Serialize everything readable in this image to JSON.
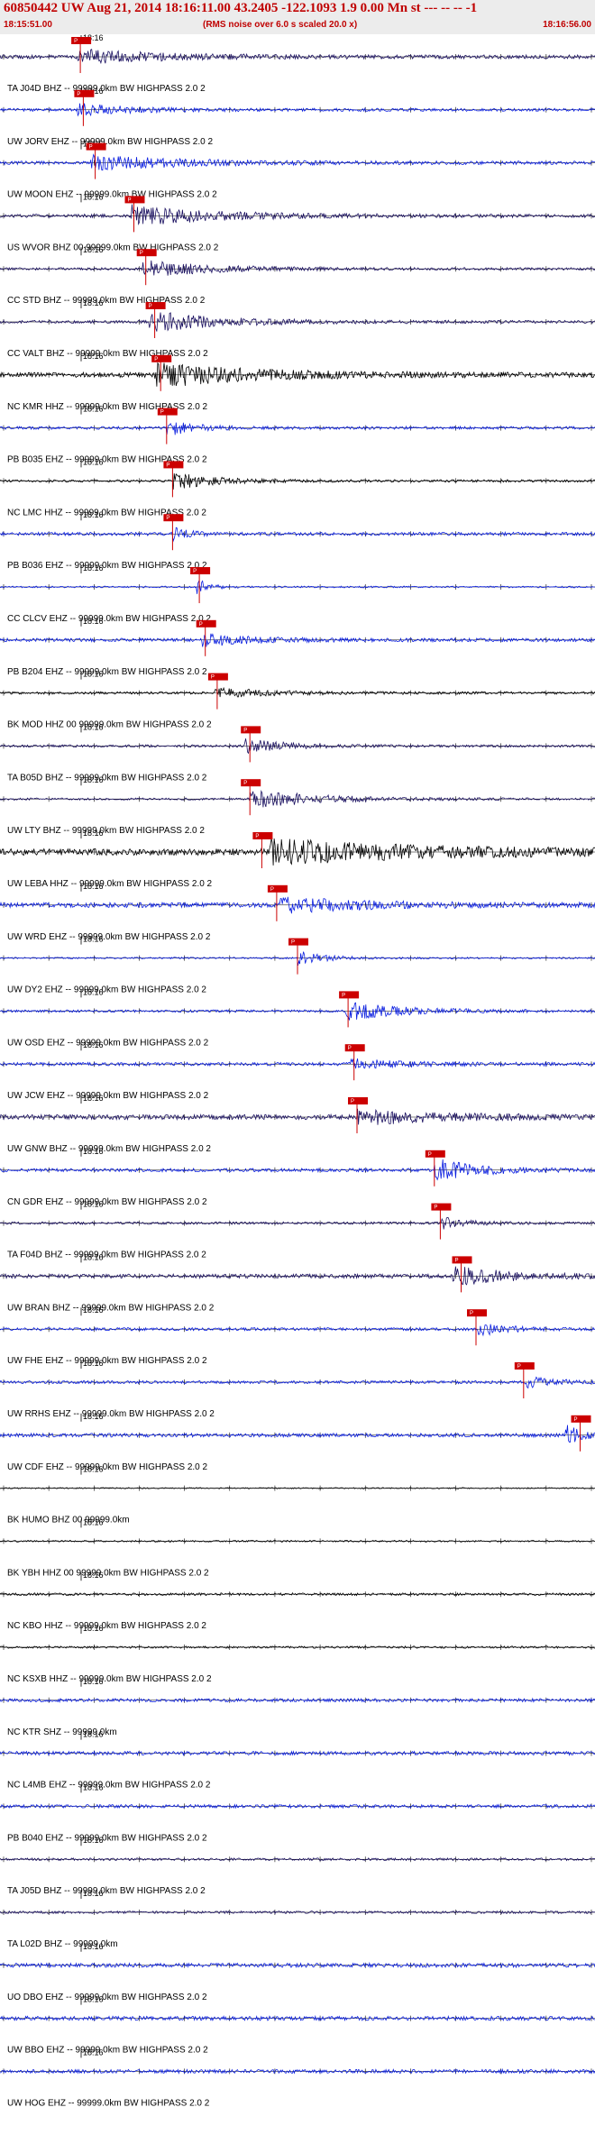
{
  "header": {
    "title": "60850442 UW Aug 21, 2014 18:16:11.00   43.2405 -122.1093  1.9 0.00 Mn st --- -- --  -1",
    "start_time": "18:15:51.00",
    "note": "(RMS noise over 6.0 s scaled 20.0 x)",
    "end_time": "18:16:56.00"
  },
  "chart_data": {
    "type": "line",
    "title": "60850442 UW Aug 21, 2014 18:16:11.00   43.2405 -122.1093  1.9 0.00 Mn st --- -- --  -1",
    "subtitle": "(RMS noise over 6.0 s scaled 20.0 x)",
    "x_range": [
      "18:15:51.00",
      "18:16:56.00"
    ],
    "minute_mark": "18:16",
    "pick_label": "P",
    "colors": {
      "dark": "#1a1060",
      "blue": "#0a1ee0",
      "black": "#000000",
      "pick": "#cc0000"
    },
    "traces": [
      {
        "name": "TA J04D BHZ -- 99999.0km BW  HIGHPASS  2.0  2",
        "color": "dark",
        "pick": 0.135,
        "event": [
          0.13,
          0.3,
          0.6
        ],
        "noise": 0.45
      },
      {
        "name": "UW JORV EHZ -- 99999.0km BW  HIGHPASS  2.0  2",
        "color": "blue",
        "pick": 0.14,
        "event": [
          0.13,
          0.2,
          0.5
        ],
        "noise": 0.35
      },
      {
        "name": "UW MOON EHZ -- 99999.0km BW  HIGHPASS  2.0  2",
        "color": "blue",
        "pick": 0.16,
        "event": [
          0.15,
          0.35,
          0.6
        ],
        "noise": 0.4
      },
      {
        "name": "US WVOR BHZ 00 99999.0km BW  HIGHPASS  2.0  2",
        "color": "dark",
        "pick": 0.225,
        "event": [
          0.22,
          0.3,
          0.9
        ],
        "noise": 0.4
      },
      {
        "name": "CC STD BHZ -- 99999.0km BW  HIGHPASS  2.0  2",
        "color": "dark",
        "pick": 0.245,
        "event": [
          0.24,
          0.25,
          0.7
        ],
        "noise": 0.3
      },
      {
        "name": "CC VALT BHZ -- 99999.0km BW  HIGHPASS  2.0  2",
        "color": "dark",
        "pick": 0.26,
        "event": [
          0.25,
          0.25,
          0.9
        ],
        "noise": 0.35
      },
      {
        "name": "NC KMR HHZ -- 99999.0km BW  HIGHPASS  2.0  2",
        "color": "black",
        "pick": 0.27,
        "event": [
          0.26,
          0.35,
          1.0
        ],
        "noise": 0.6
      },
      {
        "name": "PB B035 EHZ -- 99999.0km BW  HIGHPASS  2.0  2",
        "color": "blue",
        "pick": 0.28,
        "event": [
          0.28,
          0.1,
          0.7
        ],
        "noise": 0.35
      },
      {
        "name": "NC LMC HHZ -- 99999.0km BW  HIGHPASS  2.0  2",
        "color": "black",
        "pick": 0.29,
        "event": [
          0.29,
          0.15,
          0.7
        ],
        "noise": 0.3
      },
      {
        "name": "PB B036 EHZ -- 99999.0km BW  HIGHPASS  2.0  2",
        "color": "blue",
        "pick": 0.29,
        "event": [
          0.29,
          0.05,
          0.6
        ],
        "noise": 0.4
      },
      {
        "name": "CC CLCV EHZ -- 99999.0km BW  HIGHPASS  2.0  2",
        "color": "blue",
        "pick": 0.335,
        "event": [
          0.33,
          0.05,
          0.7
        ],
        "noise": 0.2
      },
      {
        "name": "PB B204 EHZ -- 99999.0km BW  HIGHPASS  2.0  2",
        "color": "blue",
        "pick": 0.345,
        "event": [
          0.34,
          0.2,
          0.5
        ],
        "noise": 0.4
      },
      {
        "name": "BK MOD HHZ 00 99999.0km BW  HIGHPASS  2.0  2",
        "color": "black",
        "pick": 0.365,
        "event": [
          0.36,
          0.2,
          0.4
        ],
        "noise": 0.3
      },
      {
        "name": "TA B05D BHZ -- 99999.0km BW  HIGHPASS  2.0  2",
        "color": "dark",
        "pick": 0.42,
        "event": [
          0.41,
          0.15,
          0.6
        ],
        "noise": 0.3
      },
      {
        "name": "UW LTY BHZ -- 99999.0km BW  HIGHPASS  2.0  2",
        "color": "dark",
        "pick": 0.42,
        "event": [
          0.42,
          0.25,
          0.8
        ],
        "noise": 0.25
      },
      {
        "name": "UW LEBA HHZ -- 99999.0km BW  HIGHPASS  2.0  2",
        "color": "black",
        "pick": 0.44,
        "event": [
          0.45,
          0.55,
          1.0
        ],
        "noise": 0.8
      },
      {
        "name": "UW WRD EHZ -- 99999.0km BW  HIGHPASS  2.0  2",
        "color": "blue",
        "pick": 0.465,
        "event": [
          0.47,
          0.3,
          0.6
        ],
        "noise": 0.6
      },
      {
        "name": "UW DY2 EHZ -- 99999.0km BW  HIGHPASS  2.0  2",
        "color": "blue",
        "pick": 0.5,
        "event": [
          0.5,
          0.1,
          0.6
        ],
        "noise": 0.2
      },
      {
        "name": "UW OSD EHZ -- 99999.0km BW  HIGHPASS  2.0  2",
        "color": "blue",
        "pick": 0.585,
        "event": [
          0.58,
          0.2,
          0.8
        ],
        "noise": 0.3
      },
      {
        "name": "UW JCW EHZ -- 99999.0km BW  HIGHPASS  2.0  2",
        "color": "blue",
        "pick": 0.595,
        "event": [
          0.59,
          0.2,
          0.4
        ],
        "noise": 0.4
      },
      {
        "name": "UW GNW BHZ -- 99999.0km BW  HIGHPASS  2.0  2",
        "color": "dark",
        "pick": 0.6,
        "event": [
          0.6,
          0.3,
          0.6
        ],
        "noise": 0.6
      },
      {
        "name": "CN GDR EHZ -- 99999.0km BW  HIGHPASS  2.0  2",
        "color": "blue",
        "pick": 0.73,
        "event": [
          0.73,
          0.15,
          1.0
        ],
        "noise": 0.4
      },
      {
        "name": "TA F04D BHZ -- 99999.0km BW  HIGHPASS  2.0  2",
        "color": "dark",
        "pick": 0.74,
        "event": [
          0.74,
          0.1,
          0.5
        ],
        "noise": 0.3
      },
      {
        "name": "UW BRAN BHZ -- 99999.0km BW  HIGHPASS  2.0  2",
        "color": "dark",
        "pick": 0.775,
        "event": [
          0.76,
          0.2,
          0.8
        ],
        "noise": 0.5
      },
      {
        "name": "UW FHE EHZ -- 99999.0km BW  HIGHPASS  2.0  2",
        "color": "blue",
        "pick": 0.8,
        "event": [
          0.8,
          0.1,
          0.6
        ],
        "noise": 0.35
      },
      {
        "name": "UW RRHS EHZ -- 99999.0km BW  HIGHPASS  2.0  2",
        "color": "blue",
        "pick": 0.88,
        "event": [
          0.88,
          0.1,
          0.5
        ],
        "noise": 0.35
      },
      {
        "name": "UW CDF EHZ -- 99999.0km BW  HIGHPASS  2.0  2",
        "color": "blue",
        "pick": 0.975,
        "event": [
          0.95,
          0.05,
          1.0
        ],
        "noise": 0.45
      },
      {
        "name": "BK HUMO BHZ 00 99999.0km",
        "color": "black",
        "pick": null,
        "event": null,
        "noise": 0.15
      },
      {
        "name": "BK YBH HHZ 00 99999.0km BW  HIGHPASS  2.0  2",
        "color": "black",
        "pick": null,
        "event": null,
        "noise": 0.2
      },
      {
        "name": "NC KBO HHZ -- 99999.0km BW  HIGHPASS  2.0  2",
        "color": "black",
        "pick": null,
        "event": null,
        "noise": 0.3
      },
      {
        "name": "NC KSXB HHZ -- 99999.0km BW  HIGHPASS  2.0  2",
        "color": "black",
        "pick": null,
        "event": null,
        "noise": 0.25
      },
      {
        "name": "NC KTR SHZ -- 99999.0km",
        "color": "blue",
        "pick": null,
        "event": null,
        "noise": 0.4
      },
      {
        "name": "NC L4MB EHZ -- 99999.0km BW  HIGHPASS  2.0  2",
        "color": "blue",
        "pick": null,
        "event": null,
        "noise": 0.45
      },
      {
        "name": "PB B040 EHZ -- 99999.0km BW  HIGHPASS  2.0  2",
        "color": "blue",
        "pick": null,
        "event": null,
        "noise": 0.4
      },
      {
        "name": "TA J05D BHZ -- 99999.0km BW  HIGHPASS  2.0  2",
        "color": "dark",
        "pick": null,
        "event": null,
        "noise": 0.3
      },
      {
        "name": "TA L02D BHZ -- 99999.0km",
        "color": "dark",
        "pick": null,
        "event": null,
        "noise": 0.3
      },
      {
        "name": "UO DBO EHZ -- 99999.0km BW  HIGHPASS  2.0  2",
        "color": "blue",
        "pick": null,
        "event": null,
        "noise": 0.5
      },
      {
        "name": "UW BBO EHZ -- 99999.0km BW  HIGHPASS  2.0  2",
        "color": "blue",
        "pick": null,
        "event": null,
        "noise": 0.5
      },
      {
        "name": "UW HOG EHZ -- 99999.0km BW  HIGHPASS  2.0  2",
        "color": "blue",
        "pick": null,
        "event": null,
        "noise": 0.45
      }
    ]
  }
}
